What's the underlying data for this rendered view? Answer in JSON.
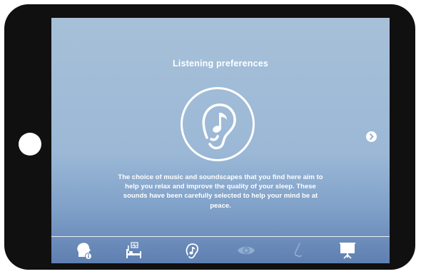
{
  "screen": {
    "title": "Listening preferences",
    "description": "The choice of music and soundscapes that you find here aim to help you relax and improve the quality of your sleep. These sounds have been carefully selected to help your mind be at peace.",
    "hero_icon": "ear-music-note-icon",
    "next_icon": "chevron-right-icon"
  },
  "tabbar": {
    "tabs": [
      {
        "icon": "head-info-icon",
        "active": true
      },
      {
        "icon": "bed-monitor-icon",
        "active": true
      },
      {
        "icon": "ear-music-icon",
        "active": true
      },
      {
        "icon": "eye-icon",
        "active": false
      },
      {
        "icon": "nose-icon",
        "active": false
      },
      {
        "icon": "presentation-screen-icon",
        "active": true
      }
    ]
  },
  "colors": {
    "bezel": "#101010",
    "screen_top": "#a7c0d8",
    "screen_bottom": "#5e7fb1",
    "text": "#ffffff"
  }
}
